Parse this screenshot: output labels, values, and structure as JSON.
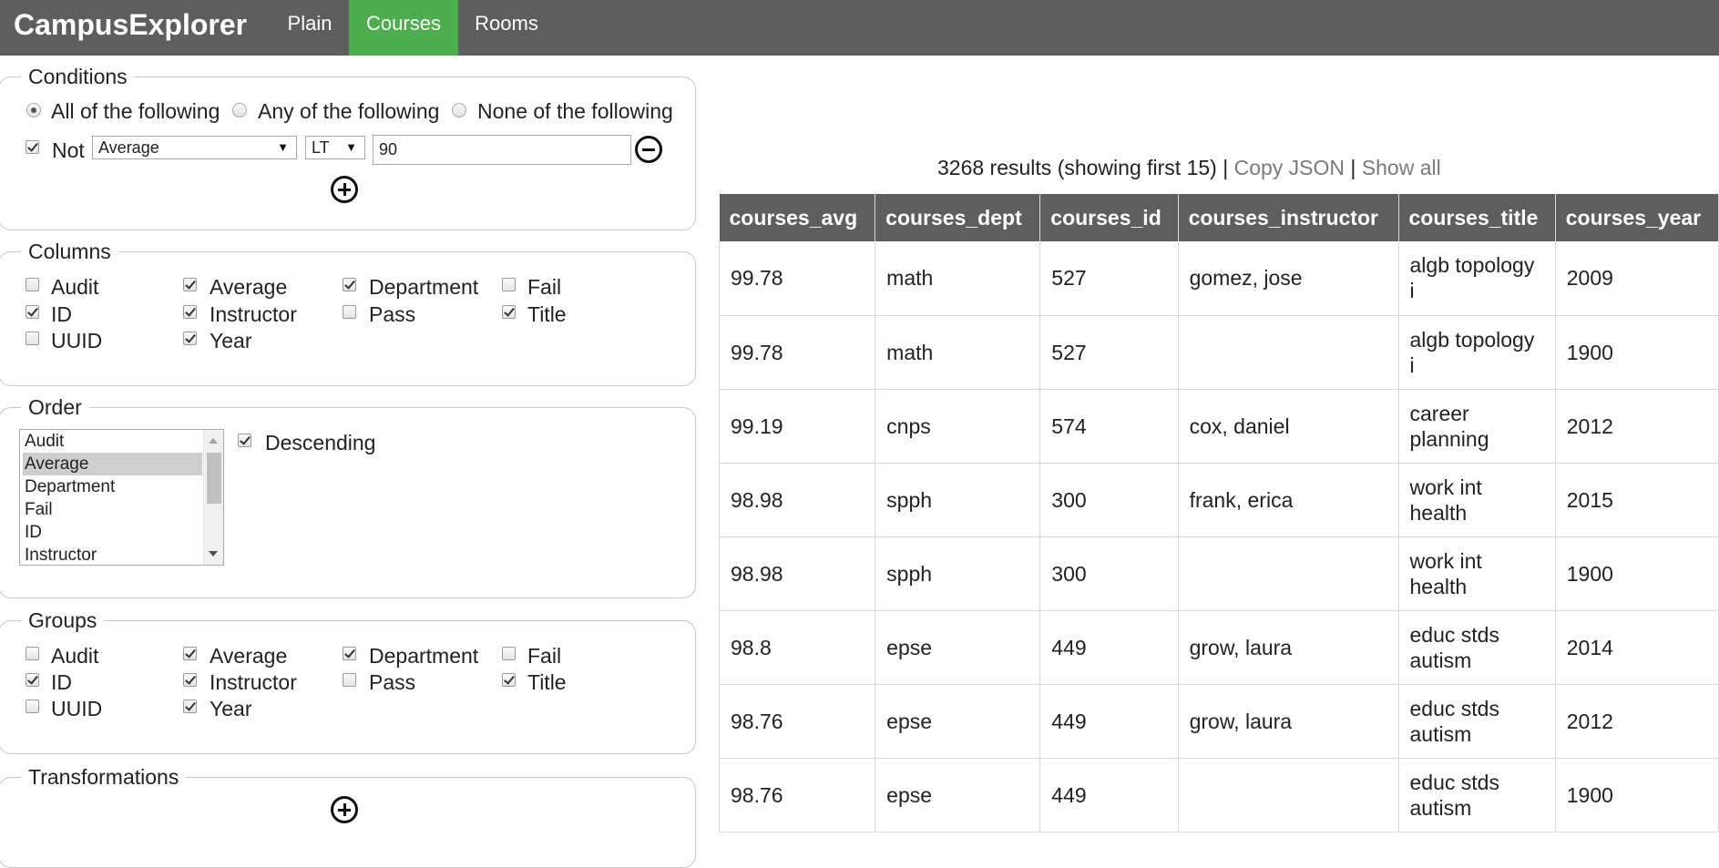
{
  "nav": {
    "brand": "CampusExplorer",
    "tabs": [
      {
        "label": "Plain",
        "active": false
      },
      {
        "label": "Courses",
        "active": true
      },
      {
        "label": "Rooms",
        "active": false
      }
    ],
    "active_color": "#4cae4c",
    "bar_color": "#5e5e5e"
  },
  "conditions": {
    "legend": "Conditions",
    "radios": [
      {
        "label": "All of the following",
        "checked": true
      },
      {
        "label": "Any of the following",
        "checked": false
      },
      {
        "label": "None of the following",
        "checked": false
      }
    ],
    "row": {
      "not_checked": true,
      "not_label": "Not",
      "field": "Average",
      "operator": "LT",
      "value": "90"
    }
  },
  "columns": {
    "legend": "Columns",
    "items": [
      {
        "label": "Audit",
        "checked": false
      },
      {
        "label": "Average",
        "checked": true
      },
      {
        "label": "Department",
        "checked": true
      },
      {
        "label": "Fail",
        "checked": false
      },
      {
        "label": "ID",
        "checked": true
      },
      {
        "label": "Instructor",
        "checked": true
      },
      {
        "label": "Pass",
        "checked": false
      },
      {
        "label": "Title",
        "checked": true
      },
      {
        "label": "UUID",
        "checked": false
      },
      {
        "label": "Year",
        "checked": true
      }
    ]
  },
  "order": {
    "legend": "Order",
    "options": [
      "Audit",
      "Average",
      "Department",
      "Fail",
      "ID",
      "Instructor"
    ],
    "selected": "Average",
    "descending_label": "Descending",
    "descending_checked": true
  },
  "groups": {
    "legend": "Groups",
    "items": [
      {
        "label": "Audit",
        "checked": false
      },
      {
        "label": "Average",
        "checked": true
      },
      {
        "label": "Department",
        "checked": true
      },
      {
        "label": "Fail",
        "checked": false
      },
      {
        "label": "ID",
        "checked": true
      },
      {
        "label": "Instructor",
        "checked": true
      },
      {
        "label": "Pass",
        "checked": false
      },
      {
        "label": "Title",
        "checked": true
      },
      {
        "label": "UUID",
        "checked": false
      },
      {
        "label": "Year",
        "checked": true
      }
    ]
  },
  "transformations": {
    "legend": "Transformations"
  },
  "results": {
    "count_text": "3268 results (showing first 15)",
    "sep1": "|",
    "copy_json": "Copy JSON",
    "sep2": "|",
    "show_all": "Show all",
    "headers": [
      "courses_avg",
      "courses_dept",
      "courses_id",
      "courses_instructor",
      "courses_title",
      "courses_year"
    ],
    "rows": [
      [
        "99.78",
        "math",
        "527",
        "gomez, jose",
        "algb topology i",
        "2009"
      ],
      [
        "99.78",
        "math",
        "527",
        "",
        "algb topology i",
        "1900"
      ],
      [
        "99.19",
        "cnps",
        "574",
        "cox, daniel",
        "career planning",
        "2012"
      ],
      [
        "98.98",
        "spph",
        "300",
        "frank, erica",
        "work int health",
        "2015"
      ],
      [
        "98.98",
        "spph",
        "300",
        "",
        "work int health",
        "1900"
      ],
      [
        "98.8",
        "epse",
        "449",
        "grow, laura",
        "educ stds autism",
        "2014"
      ],
      [
        "98.76",
        "epse",
        "449",
        "grow, laura",
        "educ stds autism",
        "2012"
      ],
      [
        "98.76",
        "epse",
        "449",
        "",
        "educ stds autism",
        "1900"
      ]
    ]
  }
}
